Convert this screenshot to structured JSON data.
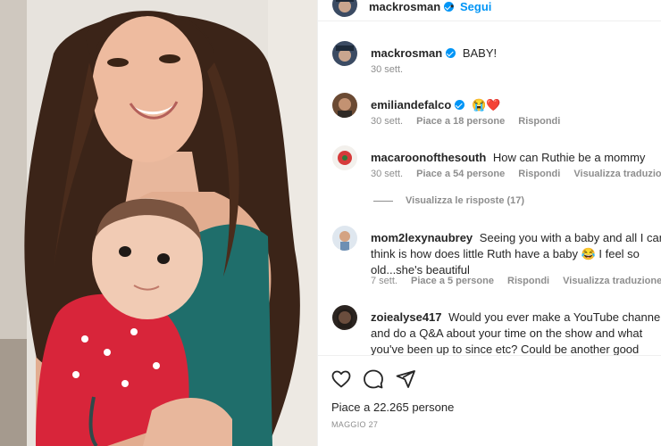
{
  "post": {
    "author": "mackrosman",
    "follow_label": "Segui",
    "dot": "•"
  },
  "comments": [
    {
      "user": "mackrosman",
      "text": "BABY!",
      "time": "30 sett.",
      "likes": "",
      "reply": "",
      "translate": ""
    },
    {
      "user": "emiliandefalco",
      "text": "😭❤️",
      "time": "30 sett.",
      "likes": "Piace a 18 persone",
      "reply": "Rispondi",
      "translate": ""
    },
    {
      "user": "macaroonofthesouth",
      "text": "How can Ruthie be a mommy",
      "time": "30 sett.",
      "likes": "Piace a 54 persone",
      "reply": "Rispondi",
      "translate": "Visualizza traduzione"
    },
    {
      "user": "mom2lexynaubrey",
      "text": "Seeing you with a baby and all I can think is how does little Ruth have a baby 😂 I feel so old...she's beautiful",
      "time": "7 sett.",
      "likes": "Piace a 5 persone",
      "reply": "Rispondi",
      "translate": "Visualizza traduzione"
    },
    {
      "user": "zoiealyse417",
      "text": "Would you ever make a YouTube channel and do a Q&A about your time on the show and what you've been up to since etc? Could be another good source of income too 😊",
      "time": "",
      "likes": "",
      "reply": "",
      "translate": ""
    }
  ],
  "view_replies": "Visualizza le risposte (17)",
  "footer": {
    "likes": "Piace a 22.265 persone",
    "date": "MAGGIO 27"
  },
  "icons": [
    "heart-icon",
    "comment-icon",
    "share-icon",
    "verified-badge-icon"
  ],
  "colors": {
    "link": "#0095f6",
    "secondary": "#8e8e8e",
    "text": "#262626"
  }
}
